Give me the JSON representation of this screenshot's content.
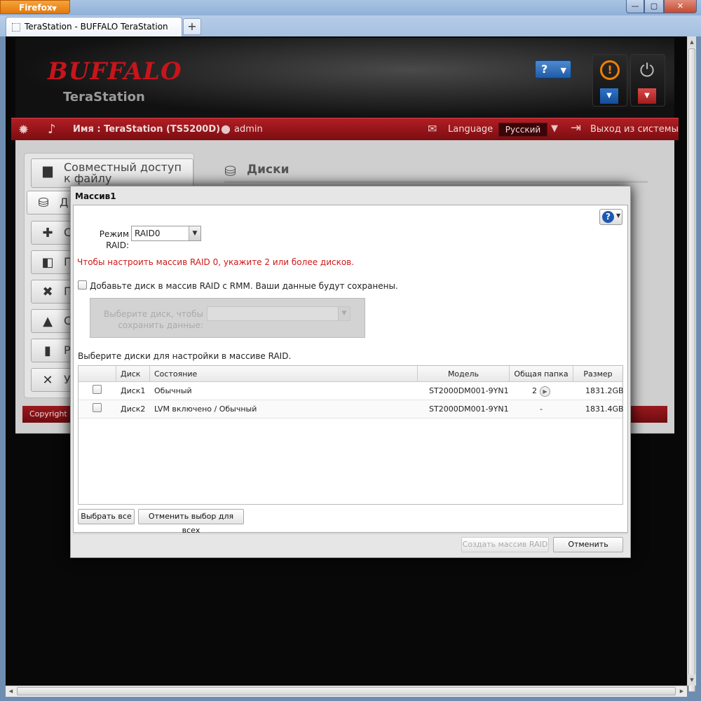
{
  "browser": {
    "app_button": "Firefox",
    "tab_title": "TeraStation - BUFFALO TeraStation",
    "new_tab": "+",
    "min": "—",
    "max": "▢",
    "close": "✕"
  },
  "header": {
    "brand": "BUFFALO",
    "product": "TeraStation",
    "help_label": "?"
  },
  "topbar": {
    "name_label": "Имя : TeraStation (TS5200D)",
    "user": "admin",
    "language_label": "Language",
    "language_value": "Русский",
    "logout": "Выход из системы"
  },
  "sidebar": {
    "items": [
      {
        "label": "Совместный доступ к файлу",
        "icon": "folder-icon"
      },
      {
        "label": "Д",
        "icon": "disk-icon"
      },
      {
        "label": "С",
        "icon": "network-icon"
      },
      {
        "label": "П",
        "icon": "backup-icon"
      },
      {
        "label": "П",
        "icon": "transfer-icon"
      },
      {
        "label": "С",
        "icon": "system-icon"
      },
      {
        "label": "Р",
        "icon": "extension-icon"
      },
      {
        "label": "У",
        "icon": "tools-icon"
      }
    ]
  },
  "main": {
    "title": "Диски",
    "copyright": "Copyright ©"
  },
  "dialog": {
    "title": "Массив1",
    "raid_mode_label": "Режим RAID:",
    "raid_mode_value": "RAID0",
    "error": "Чтобы настроить массив RAID 0, укажите 2 или более дисков.",
    "rmm_label": "Добавьте диск в массив RAID с RMM. Ваши данные будут сохранены.",
    "rmm_select_label": "Выберите диск, чтобы сохранить данные:",
    "select_disks_label": "Выберите диски для настройки в массиве RAID.",
    "columns": [
      "Диск",
      "Состояние",
      "Модель",
      "Общая папка",
      "Размер"
    ],
    "rows": [
      {
        "disk": "Диск1",
        "state": "Обычный",
        "model": "ST2000DM001-9YN1",
        "shared": "2",
        "size": "1831.2GB"
      },
      {
        "disk": "Диск2",
        "state": "LVM включено / Обычный",
        "model": "ST2000DM001-9YN1",
        "shared": "-",
        "size": "1831.4GB"
      }
    ],
    "select_all": "Выбрать все",
    "deselect_all": "Отменить выбор для всех",
    "create": "Создать массив RAID",
    "cancel": "Отменить"
  }
}
